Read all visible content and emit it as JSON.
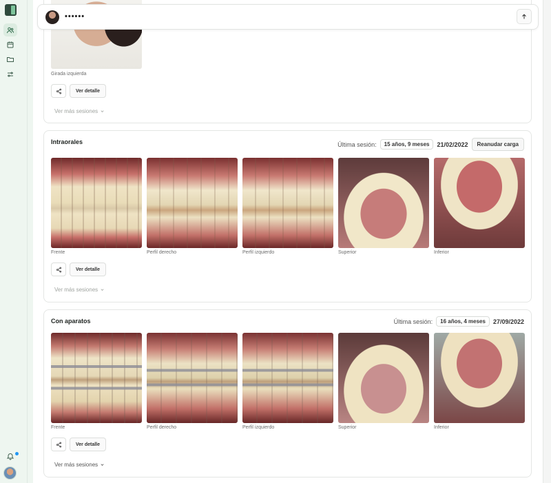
{
  "patient": {
    "name": "••••••"
  },
  "top_card": {
    "photo_label": "Girada izquierda",
    "detail_label": "Ver detalle",
    "more_label": "Ver más sesiones"
  },
  "sections": [
    {
      "title": "Intraorales",
      "session_label": "Última sesión:",
      "session_age": "15 años, 9 meses",
      "session_date": "21/02/2022",
      "resume_label": "Reanudar carga",
      "photos": [
        "Frente",
        "Perfil derecho",
        "Perfil izquierdo",
        "Superior",
        "Inferior"
      ],
      "detail_label": "Ver detalle",
      "more_label": "Ver más sesiones"
    },
    {
      "title": "Con aparatos",
      "session_label": "Última sesión:",
      "session_age": "16 años, 4 meses",
      "session_date": "27/09/2022",
      "photos": [
        "Frente",
        "Perfil derecho",
        "Perfil izquierdo",
        "Superior",
        "Inferior"
      ],
      "detail_label": "Ver detalle",
      "more_label": "Ver más sesiones"
    }
  ],
  "icons": {
    "logo": "app-logo",
    "nav": [
      "users-icon",
      "calendar-icon",
      "folder-icon",
      "settings-sliders-icon"
    ],
    "notification": "bell-icon",
    "share": "share-icon",
    "chevron": "chevron-down-icon",
    "scroll_top": "arrow-up-icon"
  },
  "colors": {
    "rail_bg": "#eef6f0",
    "notification_dot": "#2196f3"
  }
}
